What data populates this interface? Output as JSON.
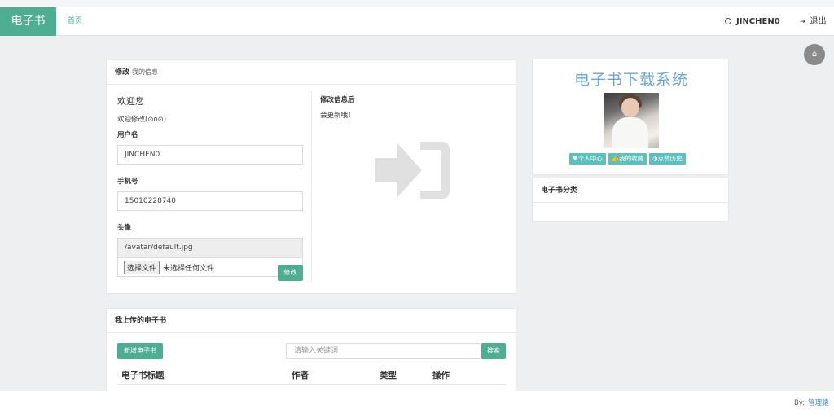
{
  "navbar": {
    "brand": "电子书",
    "home": "首页",
    "username": "JINCHEN0",
    "logout": "退出"
  },
  "edit_panel": {
    "title": "修改",
    "subtitle": "我的信息",
    "welcome": "欢迎您",
    "welcome_sub": "欢迎修改(⊙o⊙)",
    "username_label": "用户名",
    "username_value": "JINCHEN0",
    "phone_label": "手机号",
    "phone_value": "15010228740",
    "avatar_label": "头像",
    "avatar_path": "/avatar/default.jpg",
    "file_button": "选择文件",
    "file_status": "未选择任何文件",
    "save_button": "修改",
    "info_title": "修改信息后",
    "info_sub": "会更新哦！"
  },
  "books_panel": {
    "title": "我上传的电子书",
    "add_button": "新增电子书",
    "search_placeholder": "请输入关键词",
    "search_button": "搜索",
    "columns": [
      "电子书标题",
      "作者",
      "类型",
      "操作"
    ]
  },
  "profile": {
    "system_title": "电子书下载系统",
    "tags": [
      "♥个人中心",
      "👍我的收藏",
      "◑点赞历史"
    ],
    "tag_color": "#5bc0be"
  },
  "category": {
    "title": "电子书分类"
  },
  "footer": {
    "by": "By:",
    "author": "管理猿"
  },
  "colors": {
    "accent": "#4fad91",
    "title_blue": "#6aa6cf"
  }
}
